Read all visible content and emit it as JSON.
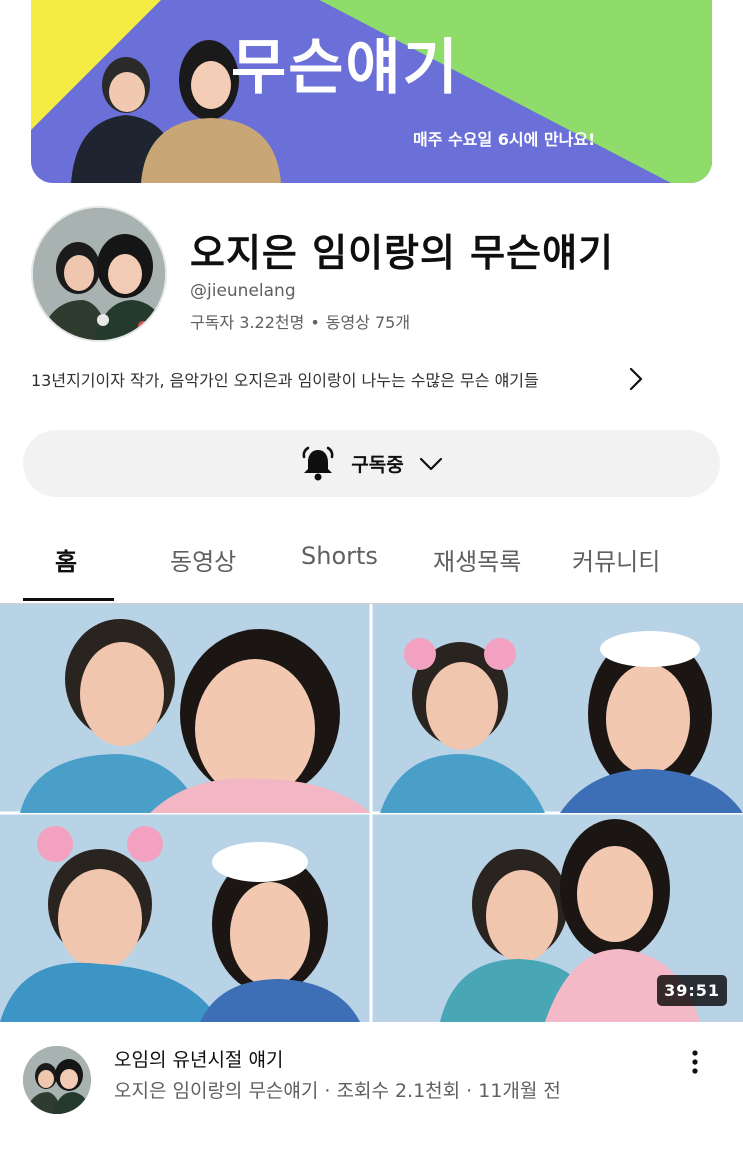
{
  "banner": {
    "title": "무슨얘기",
    "subtitle": "매주 수요일 6시에 만나요!",
    "colors": {
      "yellow": "#f5ec43",
      "green": "#8fdc6b",
      "purple": "#6b6fd8"
    }
  },
  "channel": {
    "name": "오지은 임이랑의 무슨얘기",
    "handle": "@jieunelang",
    "subscribers": "구독자 3.22천명",
    "separator": "•",
    "videos": "동영상 75개",
    "description": "13년지기이자 작가, 음악가인 오지은과 임이랑이 나누는 수많은 무슨 얘기들"
  },
  "subscribe": {
    "label": "구독중",
    "bell_icon": "bell-icon",
    "chevron_icon": "chevron-down-icon"
  },
  "tabs": [
    {
      "label": "홈",
      "active": true
    },
    {
      "label": "동영상",
      "active": false
    },
    {
      "label": "Shorts",
      "active": false
    },
    {
      "label": "재생목록",
      "active": false
    },
    {
      "label": "커뮤니티",
      "active": false
    }
  ],
  "video": {
    "duration": "39:51",
    "title": "오임의 유년시절 얘기",
    "meta": "오지은 임이랑의 무슨얘기 · 조회수 2.1천회 · 11개월 전"
  }
}
